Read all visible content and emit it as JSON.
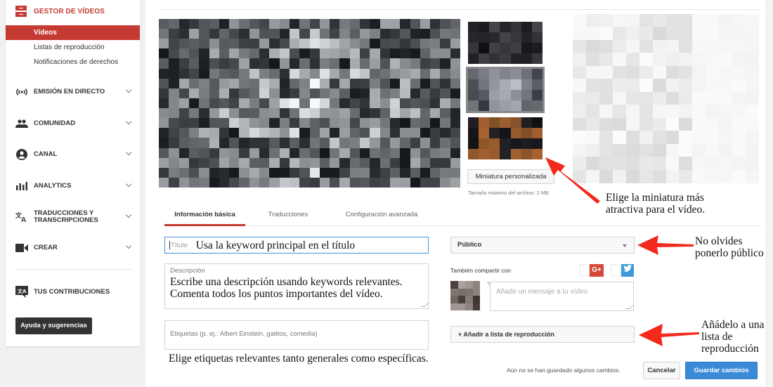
{
  "sidebar": {
    "header": {
      "label": "GESTOR DE VÍDEOS",
      "icon": "video-manager-icon"
    },
    "sub_items": [
      {
        "label": "Vídeos",
        "active": true
      },
      {
        "label": "Listas de reproducción",
        "active": false
      },
      {
        "label": "Notificaciones de derechos",
        "active": false
      }
    ],
    "sections": [
      {
        "label": "EMISIÓN EN DIRECTO",
        "icon": "live-broadcast-icon"
      },
      {
        "label": "COMUNIDAD",
        "icon": "community-icon"
      },
      {
        "label": "CANAL",
        "icon": "channel-icon"
      },
      {
        "label": "ANALYTICS",
        "icon": "analytics-icon"
      },
      {
        "label": "TRADUCCIONES Y TRANSCRIPCIONES",
        "icon": "translate-icon"
      },
      {
        "label": "CREAR",
        "icon": "create-icon"
      }
    ],
    "contributions": {
      "label": "TUS CONTRIBUCIONES",
      "icon": "contributions-icon"
    },
    "help_button": "Ayuda y sugerencias"
  },
  "thumbnails": {
    "custom_button": "Miniatura personalizada",
    "max_size": "Tamaño máximo del archivo: 2 MB",
    "selected_index": 1
  },
  "tabs": [
    {
      "label": "Información básica",
      "active": true
    },
    {
      "label": "Traducciones",
      "active": false
    },
    {
      "label": "Configuración avanzada",
      "active": false
    }
  ],
  "form": {
    "title_placeholder": "Título",
    "title_value": "Usa la keyword principal en el título",
    "description_placeholder": "Descripción",
    "description_value_line1": "Escribe una descripción usando keywords relevantes.",
    "description_value_line2": "Comenta todos los puntos importantes del vídeo.",
    "tags_placeholder": "Etiquetas (p. ej.: Albert Einstein, gatitos, comedia)",
    "tags_note": "Elige etiquetas relevantes tanto generales como específicas.",
    "privacy_value": "Público",
    "share_label": "También compartir con",
    "share_gplus": "G+",
    "share_twitter": "t",
    "message_placeholder": "Añade un mensaje a tu vídeo",
    "playlist_button": "+ Añadir a lista de reproducción",
    "unsaved_text": "Aún no se han guardado algunos cambios.",
    "cancel_button": "Cancelar",
    "save_button": "Guardar cambios"
  },
  "annotations": {
    "thumbnail_line1": "Elige la miniatura más",
    "thumbnail_line2": "atractiva para el vídeo.",
    "privacy_line1": "No olvides",
    "privacy_line2": "ponerlo público",
    "playlist_line1": "Añádelo a una",
    "playlist_line2": "lista de",
    "playlist_line3": "reproducción"
  },
  "colors": {
    "accent_red": "#c53b33",
    "save_blue": "#3a8ad7",
    "arrow_red": "#f2291b",
    "gplus_red": "#d34836",
    "twitter_blue": "#3d9ad9"
  }
}
